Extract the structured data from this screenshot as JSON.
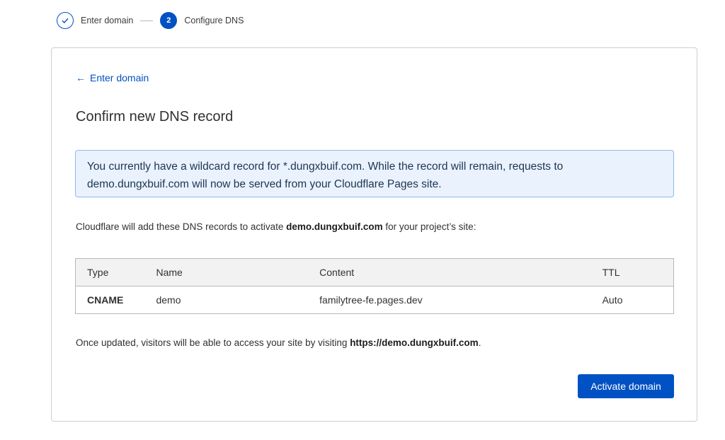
{
  "stepper": {
    "step1": {
      "label": "Enter domain",
      "state": "completed"
    },
    "step2": {
      "number": "2",
      "label": "Configure DNS",
      "state": "active"
    }
  },
  "card": {
    "back_link": "Enter domain",
    "title": "Confirm new DNS record",
    "alert": "You currently have a wildcard record for *.dungxbuif.com. While the record will remain, requests to demo.dungxbuif.com will now be served from your Cloudflare Pages site.",
    "intro": {
      "before": "Cloudflare will add these DNS records to activate ",
      "domain": "demo.dungxbuif.com",
      "after": " for your project’s site:"
    },
    "table": {
      "headers": [
        "Type",
        "Name",
        "Content",
        "TTL"
      ],
      "rows": [
        {
          "type": "CNAME",
          "name": "demo",
          "content": "familytree-fe.pages.dev",
          "ttl": "Auto"
        }
      ]
    },
    "outro": {
      "before": "Once updated, visitors will be able to access your site by visiting ",
      "url": "https://demo.dungxbuif.com",
      "after": "."
    },
    "activate_button": "Activate domain"
  },
  "colors": {
    "accent": "#0051c3",
    "alert_bg": "#eaf2fd",
    "alert_border": "#90b8ef"
  }
}
